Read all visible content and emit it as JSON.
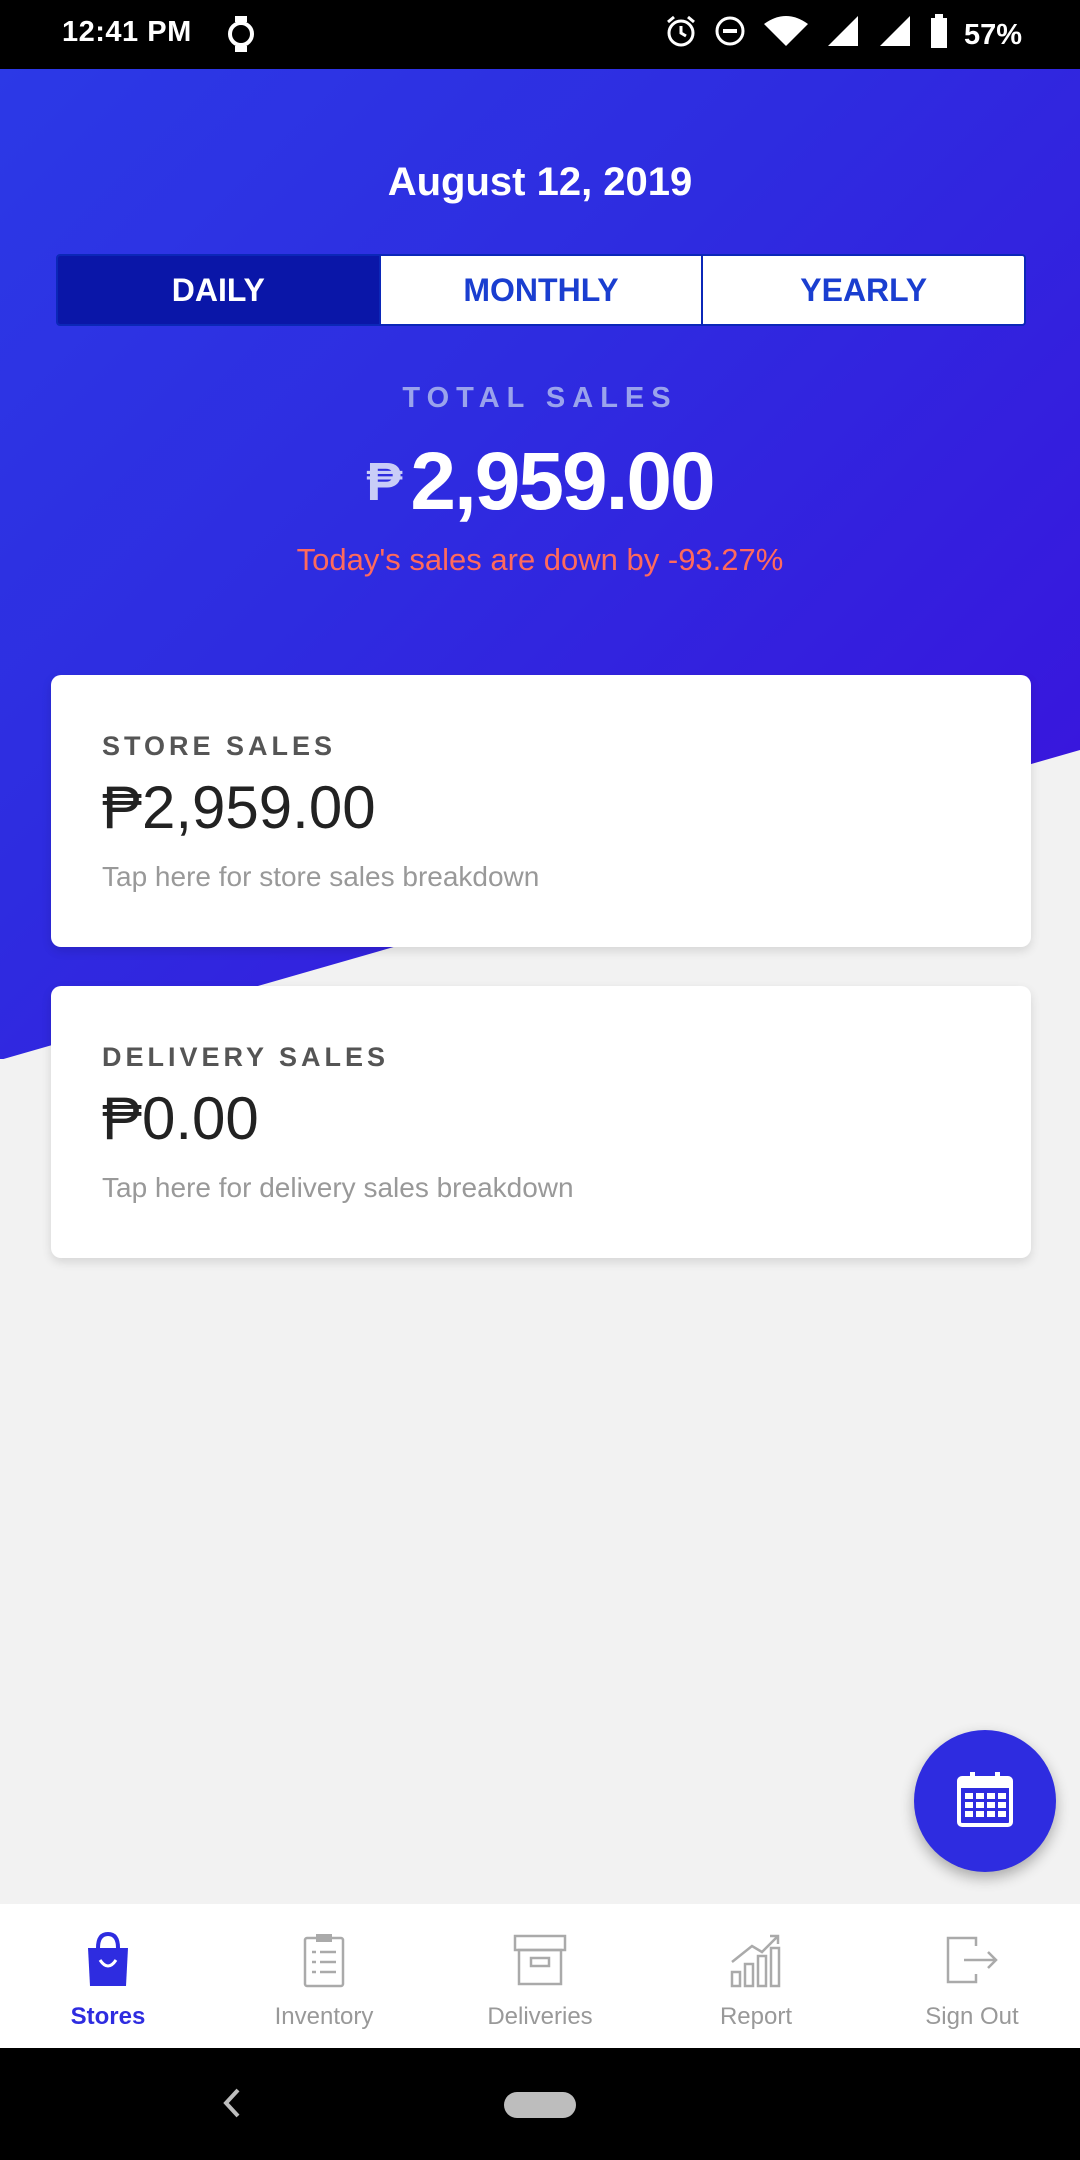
{
  "status_bar": {
    "time": "12:41 PM",
    "battery": "57%",
    "icons": [
      "watch-icon",
      "alarm-icon",
      "dnd-icon",
      "wifi-icon",
      "signal-icon",
      "signal-icon",
      "battery-icon"
    ]
  },
  "header": {
    "date": "August 12, 2019",
    "tabs": [
      {
        "label": "DAILY",
        "active": true
      },
      {
        "label": "MONTHLY",
        "active": false
      },
      {
        "label": "YEARLY",
        "active": false
      }
    ],
    "total_label": "TOTAL SALES",
    "currency": "₱",
    "total_amount": "2,959.00",
    "trend_text": "Today's sales are down by -93.27%"
  },
  "cards": [
    {
      "label": "STORE SALES",
      "value": "₱2,959.00",
      "hint": "Tap here for store sales breakdown"
    },
    {
      "label": "DELIVERY SALES",
      "value": "₱0.00",
      "hint": "Tap here for delivery sales breakdown"
    }
  ],
  "fab": {
    "icon": "calendar-icon"
  },
  "bottom_nav": [
    {
      "label": "Stores",
      "icon": "shopping-bag-icon",
      "active": true
    },
    {
      "label": "Inventory",
      "icon": "clipboard-icon",
      "active": false
    },
    {
      "label": "Deliveries",
      "icon": "box-icon",
      "active": false
    },
    {
      "label": "Report",
      "icon": "bar-chart-icon",
      "active": false
    },
    {
      "label": "Sign Out",
      "icon": "sign-out-icon",
      "active": false
    }
  ],
  "colors": {
    "primary": "#2e2ce0",
    "active_tab": "#0a16a8",
    "trend_down": "#ff6a5c"
  }
}
